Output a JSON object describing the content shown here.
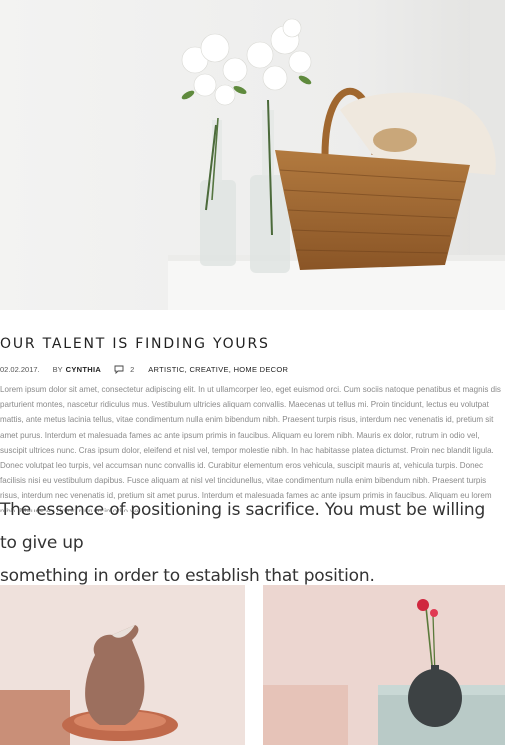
{
  "post": {
    "title": "OUR TALENT IS FINDING YOURS",
    "date": "02.02.2017.",
    "by_label": "BY",
    "author": "CYNTHIA",
    "comments_count": "2",
    "categories": "ARTISTIC, CREATIVE, HOME DECOR",
    "body": "Lorem ipsum dolor sit amet, consectetur adipiscing elit. In ut ullamcorper leo, eget euismod orci. Cum sociis natoque penatibus et magnis dis parturient montes, nascetur ridiculus mus. Vestibulum ultricies aliquam convallis. Maecenas ut tellus mi. Proin tincidunt, lectus eu volutpat mattis, ante metus lacinia tellus, vitae condimentum nulla enim bibendum nibh. Praesent turpis risus, interdum nec venenatis id, pretium sit amet purus. Interdum et malesuada fames ac ante ipsum primis in faucibus. Aliquam eu lorem nibh. Mauris ex dolor, rutrum in odio vel, suscipit ultrices nunc. Cras ipsum dolor, eleifend et nisl vel, tempor molestie nibh. In hac habitasse platea dictumst. Proin nec blandit ligula. Donec volutpat leo turpis, vel accumsan nunc convallis id. Curabitur elementum eros vehicula, suscipit mauris at, vehicula turpis. Donec facilisis nisi eu vestibulum dapibus. Fusce aliquam at nisl vel tincidunellus, vitae condimentum nulla enim bibendum nibh. Praesent turpis risus, interdum nec venenatis id, pretium sit amet purus. Interdum et malesuada fames ac ante ipsum primis in faucibus. Aliquam eu lorem nibh. Mauris ex dolor, rutrum in odio ve",
    "quote_line1": "The essence of positioning is sacrifice. You must be willing to give up",
    "quote_line2": "something in order to establish that position."
  },
  "icons": {
    "comments": "speech-bubble-icon"
  },
  "colors": {
    "title": "#222222",
    "body_text": "#8a8a8a",
    "quote_text": "#333333"
  }
}
